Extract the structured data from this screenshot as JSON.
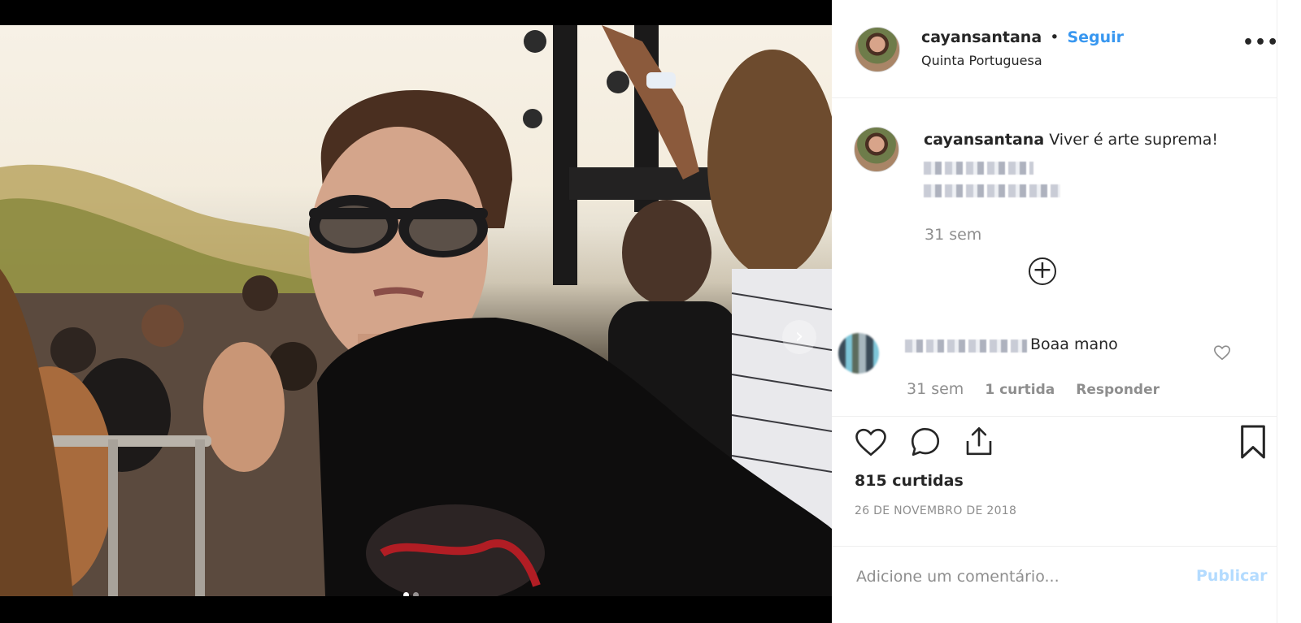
{
  "post": {
    "username": "cayansantana",
    "separator": "•",
    "follow_label": "Seguir",
    "location": "Quinta Portuguesa",
    "more_label": "•••",
    "next_label": "›"
  },
  "caption": {
    "username": "cayansantana",
    "text": "Viver é arte suprema!",
    "time": "31 sem"
  },
  "load_more_label": "+",
  "comment": {
    "text": "Boaa mano",
    "time": "31 sem",
    "likes_label": "1 curtida",
    "reply_label": "Responder"
  },
  "actions": {
    "icons": [
      "heart-icon",
      "comment-icon",
      "share-icon",
      "bookmark-icon"
    ],
    "likes": "815 curtidas",
    "date": "26 DE NOVEMBRO DE 2018"
  },
  "add_comment": {
    "placeholder": "Adicione um comentário...",
    "publish_label": "Publicar"
  },
  "colors": {
    "accent": "#3897f0",
    "publish_disabled": "#b3dbff",
    "muted": "#8e8e8e",
    "text": "#262626"
  }
}
